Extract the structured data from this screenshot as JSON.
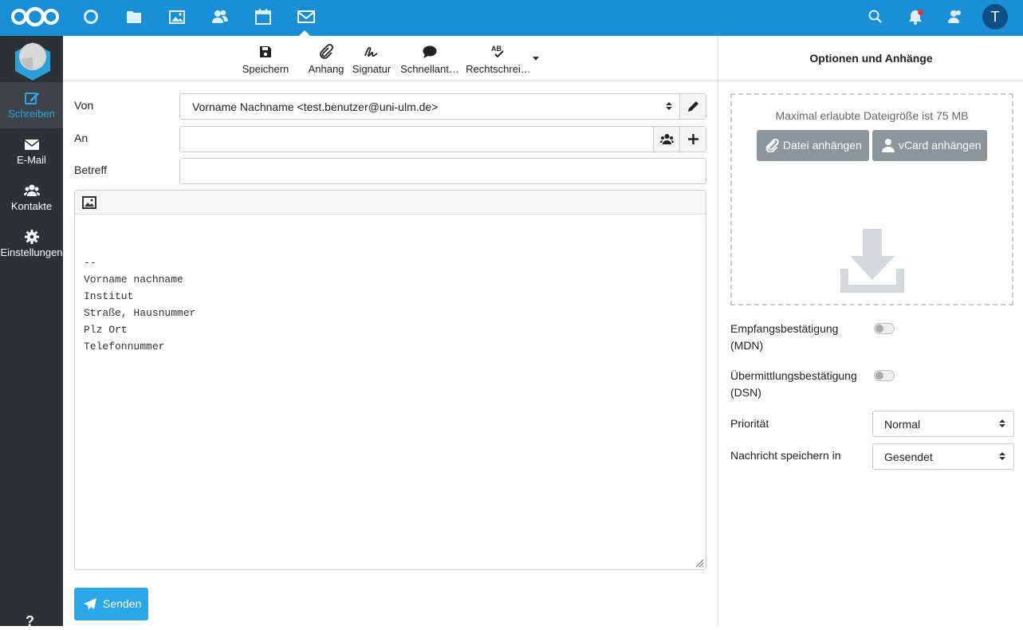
{
  "header": {
    "apps": [
      {
        "name": "dashboard-icon"
      },
      {
        "name": "files-icon"
      },
      {
        "name": "photos-icon"
      },
      {
        "name": "contacts-app-icon"
      },
      {
        "name": "calendar-icon"
      },
      {
        "name": "mail-icon",
        "active": true
      }
    ],
    "avatar_initial": "T",
    "accent": "#1a8fd6"
  },
  "nav": {
    "items": [
      {
        "label": "Schreiben",
        "icon": "compose-icon",
        "active": true
      },
      {
        "label": "E-Mail",
        "icon": "envelope-icon"
      },
      {
        "label": "Kontakte",
        "icon": "contacts-icon"
      },
      {
        "label": "Einstellungen",
        "icon": "gear-icon"
      }
    ],
    "help_label": "?"
  },
  "toolbar": {
    "save": "Speichern",
    "attachment": "Anhang",
    "signature": "Signatur",
    "quick_reply": "Schnellant…",
    "spellcheck": "Rechtschrei…"
  },
  "compose": {
    "from_label": "Von",
    "from_value": "Vorname Nachname <test.benutzer@uni-ulm.de>",
    "to_label": "An",
    "to_value": "",
    "subject_label": "Betreff",
    "subject_value": "",
    "body": "--\nVorname nachname\nInstitut\nStraße, Hausnummer\nPlz Ort\nTelefonnummer",
    "send_label": "Senden"
  },
  "options": {
    "title": "Optionen und Anhänge",
    "max_size_text": "Maximal erlaubte Dateigröße ist 75 MB",
    "attach_file": "Datei anhängen",
    "attach_vcard": "vCard anhängen",
    "mdn_label": "Empfangsbestätigung (MDN)",
    "mdn_on": false,
    "dsn_label": "Übermittlungsbestätigung (DSN)",
    "dsn_on": false,
    "priority_label": "Priorität",
    "priority_value": "Normal",
    "save_in_label": "Nachricht speichern in",
    "save_in_value": "Gesendet"
  }
}
